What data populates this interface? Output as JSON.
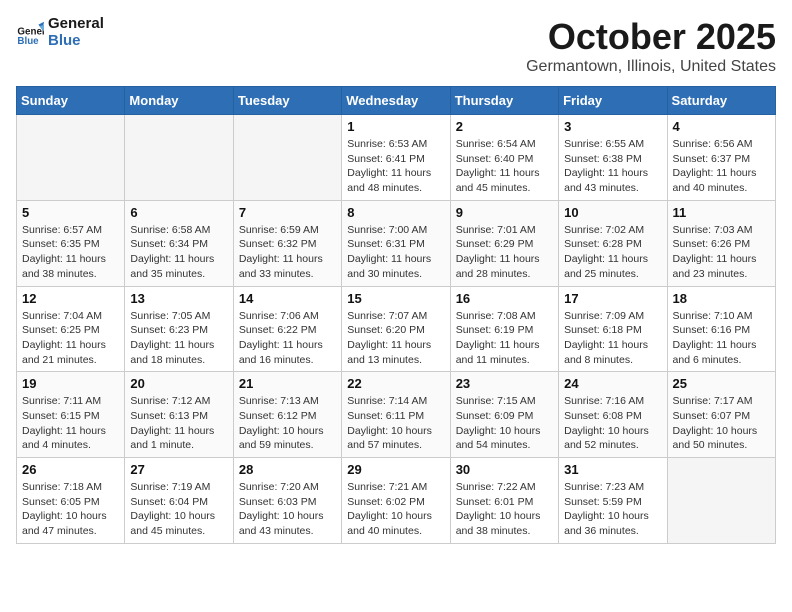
{
  "header": {
    "logo_line1": "General",
    "logo_line2": "Blue",
    "month": "October 2025",
    "location": "Germantown, Illinois, United States"
  },
  "weekdays": [
    "Sunday",
    "Monday",
    "Tuesday",
    "Wednesday",
    "Thursday",
    "Friday",
    "Saturday"
  ],
  "weeks": [
    [
      {
        "day": "",
        "info": ""
      },
      {
        "day": "",
        "info": ""
      },
      {
        "day": "",
        "info": ""
      },
      {
        "day": "1",
        "info": "Sunrise: 6:53 AM\nSunset: 6:41 PM\nDaylight: 11 hours\nand 48 minutes."
      },
      {
        "day": "2",
        "info": "Sunrise: 6:54 AM\nSunset: 6:40 PM\nDaylight: 11 hours\nand 45 minutes."
      },
      {
        "day": "3",
        "info": "Sunrise: 6:55 AM\nSunset: 6:38 PM\nDaylight: 11 hours\nand 43 minutes."
      },
      {
        "day": "4",
        "info": "Sunrise: 6:56 AM\nSunset: 6:37 PM\nDaylight: 11 hours\nand 40 minutes."
      }
    ],
    [
      {
        "day": "5",
        "info": "Sunrise: 6:57 AM\nSunset: 6:35 PM\nDaylight: 11 hours\nand 38 minutes."
      },
      {
        "day": "6",
        "info": "Sunrise: 6:58 AM\nSunset: 6:34 PM\nDaylight: 11 hours\nand 35 minutes."
      },
      {
        "day": "7",
        "info": "Sunrise: 6:59 AM\nSunset: 6:32 PM\nDaylight: 11 hours\nand 33 minutes."
      },
      {
        "day": "8",
        "info": "Sunrise: 7:00 AM\nSunset: 6:31 PM\nDaylight: 11 hours\nand 30 minutes."
      },
      {
        "day": "9",
        "info": "Sunrise: 7:01 AM\nSunset: 6:29 PM\nDaylight: 11 hours\nand 28 minutes."
      },
      {
        "day": "10",
        "info": "Sunrise: 7:02 AM\nSunset: 6:28 PM\nDaylight: 11 hours\nand 25 minutes."
      },
      {
        "day": "11",
        "info": "Sunrise: 7:03 AM\nSunset: 6:26 PM\nDaylight: 11 hours\nand 23 minutes."
      }
    ],
    [
      {
        "day": "12",
        "info": "Sunrise: 7:04 AM\nSunset: 6:25 PM\nDaylight: 11 hours\nand 21 minutes."
      },
      {
        "day": "13",
        "info": "Sunrise: 7:05 AM\nSunset: 6:23 PM\nDaylight: 11 hours\nand 18 minutes."
      },
      {
        "day": "14",
        "info": "Sunrise: 7:06 AM\nSunset: 6:22 PM\nDaylight: 11 hours\nand 16 minutes."
      },
      {
        "day": "15",
        "info": "Sunrise: 7:07 AM\nSunset: 6:20 PM\nDaylight: 11 hours\nand 13 minutes."
      },
      {
        "day": "16",
        "info": "Sunrise: 7:08 AM\nSunset: 6:19 PM\nDaylight: 11 hours\nand 11 minutes."
      },
      {
        "day": "17",
        "info": "Sunrise: 7:09 AM\nSunset: 6:18 PM\nDaylight: 11 hours\nand 8 minutes."
      },
      {
        "day": "18",
        "info": "Sunrise: 7:10 AM\nSunset: 6:16 PM\nDaylight: 11 hours\nand 6 minutes."
      }
    ],
    [
      {
        "day": "19",
        "info": "Sunrise: 7:11 AM\nSunset: 6:15 PM\nDaylight: 11 hours\nand 4 minutes."
      },
      {
        "day": "20",
        "info": "Sunrise: 7:12 AM\nSunset: 6:13 PM\nDaylight: 11 hours\nand 1 minute."
      },
      {
        "day": "21",
        "info": "Sunrise: 7:13 AM\nSunset: 6:12 PM\nDaylight: 10 hours\nand 59 minutes."
      },
      {
        "day": "22",
        "info": "Sunrise: 7:14 AM\nSunset: 6:11 PM\nDaylight: 10 hours\nand 57 minutes."
      },
      {
        "day": "23",
        "info": "Sunrise: 7:15 AM\nSunset: 6:09 PM\nDaylight: 10 hours\nand 54 minutes."
      },
      {
        "day": "24",
        "info": "Sunrise: 7:16 AM\nSunset: 6:08 PM\nDaylight: 10 hours\nand 52 minutes."
      },
      {
        "day": "25",
        "info": "Sunrise: 7:17 AM\nSunset: 6:07 PM\nDaylight: 10 hours\nand 50 minutes."
      }
    ],
    [
      {
        "day": "26",
        "info": "Sunrise: 7:18 AM\nSunset: 6:05 PM\nDaylight: 10 hours\nand 47 minutes."
      },
      {
        "day": "27",
        "info": "Sunrise: 7:19 AM\nSunset: 6:04 PM\nDaylight: 10 hours\nand 45 minutes."
      },
      {
        "day": "28",
        "info": "Sunrise: 7:20 AM\nSunset: 6:03 PM\nDaylight: 10 hours\nand 43 minutes."
      },
      {
        "day": "29",
        "info": "Sunrise: 7:21 AM\nSunset: 6:02 PM\nDaylight: 10 hours\nand 40 minutes."
      },
      {
        "day": "30",
        "info": "Sunrise: 7:22 AM\nSunset: 6:01 PM\nDaylight: 10 hours\nand 38 minutes."
      },
      {
        "day": "31",
        "info": "Sunrise: 7:23 AM\nSunset: 5:59 PM\nDaylight: 10 hours\nand 36 minutes."
      },
      {
        "day": "",
        "info": ""
      }
    ]
  ]
}
